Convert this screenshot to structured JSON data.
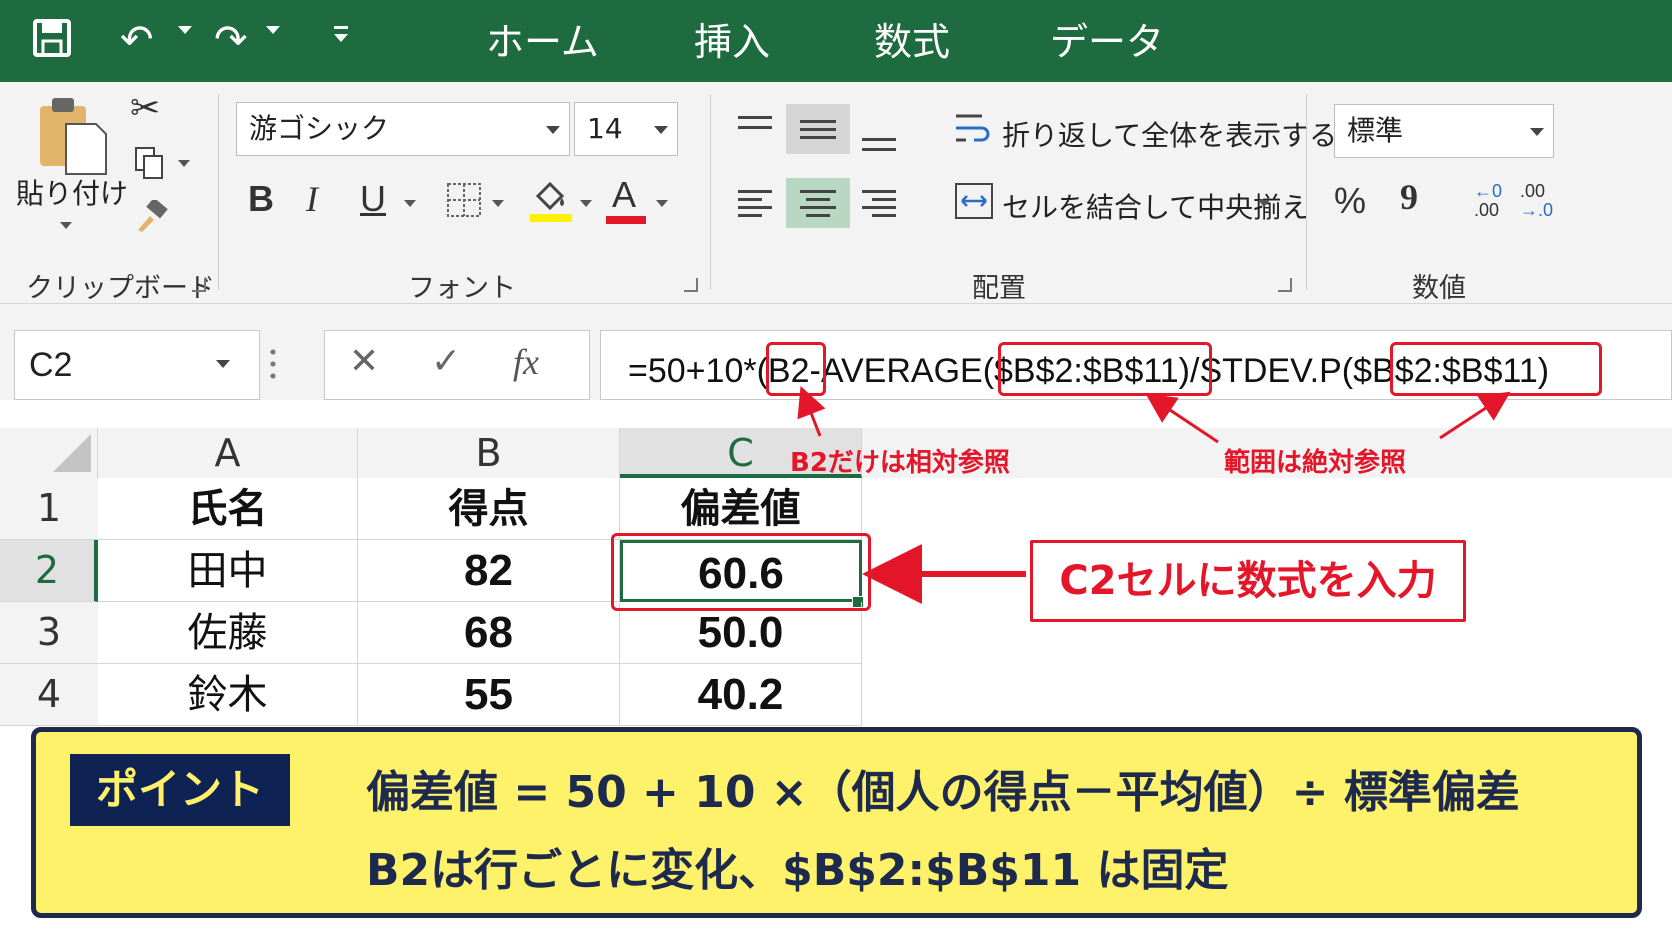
{
  "ribbon_tabs": [
    "ホーム",
    "挿入",
    "数式",
    "データ"
  ],
  "clipboard": {
    "paste_label": "貼り付け",
    "group_label": "クリップボード"
  },
  "font": {
    "name": "游ゴシック",
    "size": "14",
    "bold": "B",
    "italic": "I",
    "underline": "U",
    "font_color_letter": "A",
    "group_label": "フォント"
  },
  "alignment": {
    "wrap_text": "折り返して全体を表示する",
    "merge_center": "セルを結合して中央揃え",
    "group_label": "配置"
  },
  "number": {
    "format": "標準",
    "percent": "%",
    "comma": "9",
    "inc_decimal_top": "←0",
    "inc_decimal_bottom": ".00",
    "dec_decimal_top": ".00",
    "dec_decimal_bottom": "→.0",
    "group_label": "数値"
  },
  "formula_bar": {
    "name_box": "C2",
    "cancel": "✕",
    "enter": "✓",
    "fx": "fx",
    "formula_parts": [
      "=50+10*(",
      "B2",
      "-AVERAGE(",
      "$B$2:$B$11",
      ")/STDEV.P(",
      "$B$2:$B$11",
      ")"
    ]
  },
  "annotations": {
    "relative": "B2だけは相対参照",
    "absolute": "範囲は絶対参照",
    "callout": "C2セルに数式を入力"
  },
  "sheet": {
    "columns": [
      "A",
      "B",
      "C"
    ],
    "rows": [
      {
        "num": "1",
        "a": "氏名",
        "b": "得点",
        "c": "偏差値"
      },
      {
        "num": "2",
        "a": "田中",
        "b": "82",
        "c": "60.6"
      },
      {
        "num": "3",
        "a": "佐藤",
        "b": "68",
        "c": "50.0"
      },
      {
        "num": "4",
        "a": "鈴木",
        "b": "55",
        "c": "40.2"
      }
    ]
  },
  "point": {
    "badge": "ポイント",
    "line1": "偏差値 = 50 + 10 ×（個人の得点－平均値）÷ 標準偏差",
    "line2": "B2は行ごとに変化、$B$2:$B$11 は固定"
  },
  "colors": {
    "title_bar": "#1e6b3f",
    "accent_red": "#e3162a",
    "point_bg": "#fdf26a",
    "point_badge": "#0e2353"
  }
}
